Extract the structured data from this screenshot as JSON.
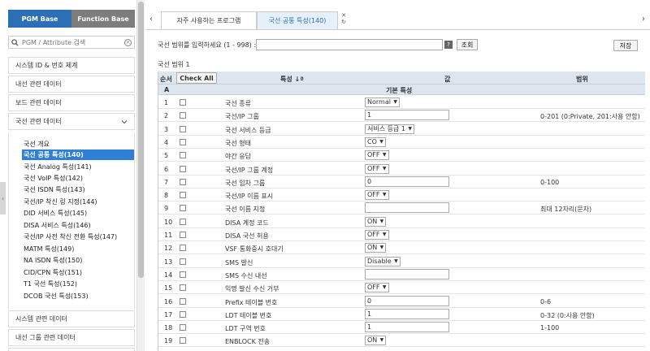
{
  "sidebar": {
    "tabs": [
      "PGM Base",
      "Function Base"
    ],
    "search_placeholder": "PGM / Attribute 검색",
    "top_menu": [
      "시스템 ID & 번호 체계",
      "내선 관련 데이터",
      "보드 관련 데이터",
      "국선 관련 데이터"
    ],
    "sub_items": [
      "국선 개요",
      "국선 공통 특성(140)",
      "국선 Analog 특성(141)",
      "국선 VoIP 특성(142)",
      "국선 ISDN 특성(143)",
      "국선/IP 착신 링 지정(144)",
      "DID 서비스 특성(145)",
      "DISA 서비스 특성(146)",
      "국선/IP 사전 착신 전환 특성(147)",
      "MATM 특성(149)",
      "NA ISDN 특성(150)",
      "CID/CPN 특성(151)",
      "T1 국선 특성(152)",
      "DCOB 국선 특성(153)"
    ],
    "bottom_menu": [
      "시스템 관련 데이터",
      "내선 그룹 관련 데이터"
    ]
  },
  "tabs": [
    "자주 사용하는 프로그램",
    "국선 공통 특성(140)"
  ],
  "filter": {
    "label": "국선 범위를 입력하세요 (1 - 998) :",
    "help": "?",
    "search_button": "조회",
    "save_button": "저장"
  },
  "range_label": "국선 범위 1",
  "table": {
    "headers": {
      "order": "순서",
      "check_all": "Check All",
      "feature": "특성 ↓ª",
      "value": "값",
      "range": "범위"
    },
    "subheader": {
      "col": "A",
      "title": "기본 특성"
    },
    "rows": [
      {
        "num": "1",
        "feature": "국선 종류",
        "value": "Normal",
        "type": "select",
        "range": ""
      },
      {
        "num": "2",
        "feature": "국선/IP 그룹",
        "value": "1",
        "type": "input",
        "range": "0-201 (0:Private, 201:사용 안함)"
      },
      {
        "num": "3",
        "feature": "국선 서비스 등급",
        "value": "서비스 등급 1",
        "type": "select",
        "range": ""
      },
      {
        "num": "4",
        "feature": "국선 형태",
        "value": "CO",
        "type": "select",
        "range": ""
      },
      {
        "num": "5",
        "feature": "야간 응답",
        "value": "OFF",
        "type": "select",
        "range": ""
      },
      {
        "num": "6",
        "feature": "국선/IP 그룹 계정",
        "value": "OFF",
        "type": "select",
        "range": ""
      },
      {
        "num": "7",
        "feature": "국선 임차 그룹",
        "value": "0",
        "type": "input",
        "range": "0-100"
      },
      {
        "num": "8",
        "feature": "국선/IP 이름 표시",
        "value": "OFF",
        "type": "select",
        "range": ""
      },
      {
        "num": "9",
        "feature": "국선 이름 지정",
        "value": "",
        "type": "input",
        "range": "최대 12자리(문자)"
      },
      {
        "num": "10",
        "feature": "DISA 계정 코드",
        "value": "ON",
        "type": "select",
        "range": ""
      },
      {
        "num": "11",
        "feature": "DISA 국선 허용",
        "value": "OFF",
        "type": "select",
        "range": ""
      },
      {
        "num": "12",
        "feature": "VSF 통화중시 호대기",
        "value": "ON",
        "type": "select",
        "range": ""
      },
      {
        "num": "13",
        "feature": "SMS 발신",
        "value": "Disable",
        "type": "select",
        "range": ""
      },
      {
        "num": "14",
        "feature": "SMS 수신 내선",
        "value": "",
        "type": "input",
        "range": ""
      },
      {
        "num": "15",
        "feature": "익명 발신 수신 거부",
        "value": "OFF",
        "type": "select",
        "range": ""
      },
      {
        "num": "16",
        "feature": "Prefix 테이블 번호",
        "value": "0",
        "type": "input",
        "range": "0-6"
      },
      {
        "num": "17",
        "feature": "LDT 테이블 번호",
        "value": "1",
        "type": "input",
        "range": "0-32 (0:사용 안함)"
      },
      {
        "num": "18",
        "feature": "LDT 구역 번호",
        "value": "1",
        "type": "input",
        "range": "1-100"
      },
      {
        "num": "19",
        "feature": "ENBLOCK 전송",
        "value": "ON",
        "type": "select",
        "range": ""
      }
    ]
  }
}
